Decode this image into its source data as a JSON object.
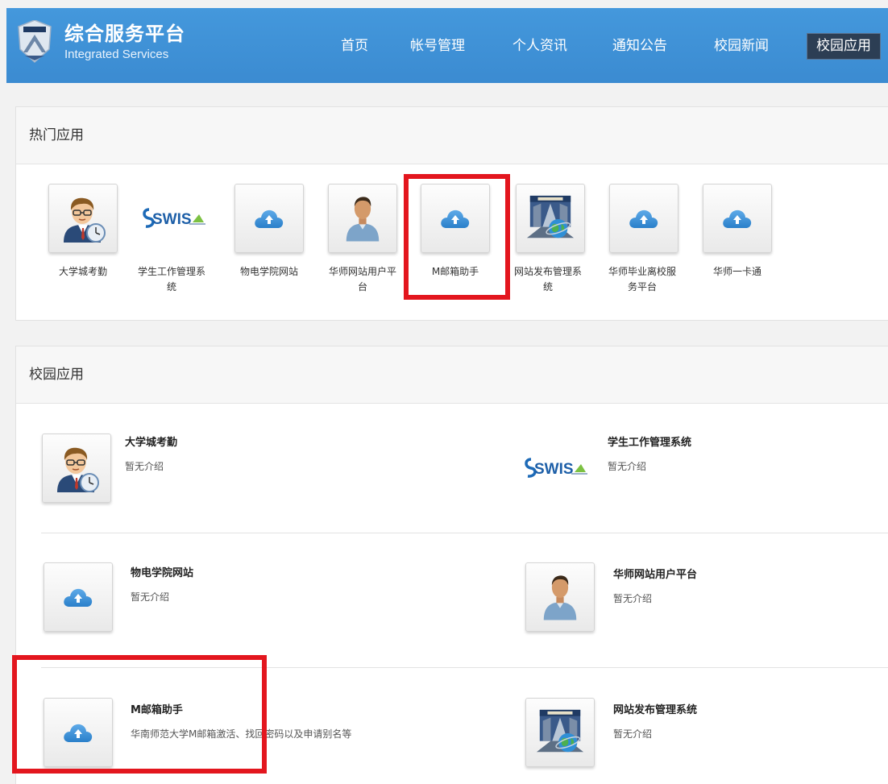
{
  "header": {
    "title": "综合服务平台",
    "subtitle": "Integrated Services",
    "nav": [
      "首页",
      "帐号管理",
      "个人资讯",
      "通知公告",
      "校园新闻",
      "校园应用"
    ],
    "active_nav": "校园应用"
  },
  "hot_apps": {
    "heading": "热门应用",
    "items": [
      {
        "label": "大学城考勤",
        "icon": "person-clock-icon"
      },
      {
        "label": "学生工作管理系统",
        "icon": "swis-logo"
      },
      {
        "label": "物电学院网站",
        "icon": "cloud-upload-icon"
      },
      {
        "label": "华师网站用户平台",
        "icon": "person-icon"
      },
      {
        "label": "M邮箱助手",
        "icon": "cloud-upload-icon"
      },
      {
        "label": "网站发布管理系统",
        "icon": "globe-building-icon"
      },
      {
        "label": "华师毕业离校服务平台",
        "icon": "cloud-upload-icon"
      },
      {
        "label": "华师一卡通",
        "icon": "cloud-upload-icon"
      }
    ]
  },
  "campus_apps": {
    "heading": "校园应用",
    "items": [
      {
        "title": "大学城考勤",
        "desc": "暂无介绍",
        "icon": "person-clock-icon"
      },
      {
        "title": "学生工作管理系统",
        "desc": "暂无介绍",
        "icon": "swis-logo"
      },
      {
        "title": "物电学院网站",
        "desc": "暂无介绍",
        "icon": "cloud-upload-icon"
      },
      {
        "title": "华师网站用户平台",
        "desc": "暂无介绍",
        "icon": "person-icon"
      },
      {
        "title": "M邮箱助手",
        "desc": "华南师范大学M邮箱激活、找回密码以及申请别名等",
        "icon": "cloud-upload-icon"
      },
      {
        "title": "网站发布管理系统",
        "desc": "暂无介绍",
        "icon": "globe-building-icon"
      }
    ]
  },
  "colors": {
    "header_bg": "#3d8fd5",
    "active_nav_bg": "#2c3e54",
    "highlight": "#e3161e",
    "cloud": "#3b8fd8"
  }
}
